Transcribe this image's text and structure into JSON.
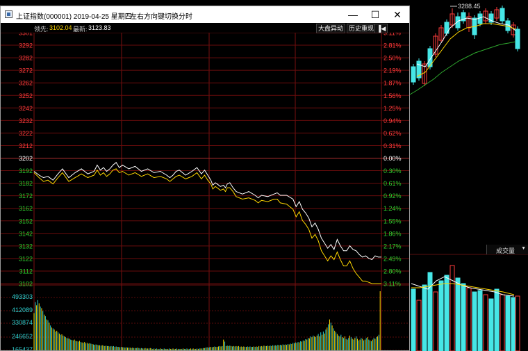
{
  "window": {
    "title": "上证指数(000001) 2019-04-25 星期四",
    "hint": "左右方向键切换分时",
    "minimize": "—",
    "maximize": "☐",
    "close": "✕"
  },
  "infobar": {
    "leader_label": "领先:",
    "leader_value": "3102.04",
    "latest_label": "最新:",
    "latest_value": "3123.83",
    "btn_market": "大盘异动",
    "btn_history": "历史重现",
    "btn_pin": "▐◀"
  },
  "background_kline": {
    "high_label": "3288.45",
    "volume_tab": "成交量",
    "volume_arrow": "▼"
  },
  "chart_data": {
    "type": "line",
    "price_ticks": [
      "3301",
      "3292",
      "3282",
      "3272",
      "3262",
      "3252",
      "3242",
      "3232",
      "3222",
      "3212",
      "3202",
      "3192",
      "3182",
      "3172",
      "3162",
      "3152",
      "3142",
      "3132",
      "3122",
      "3112",
      "3102"
    ],
    "pct_ticks": [
      "3.11%",
      "2.81%",
      "2.50%",
      "2.19%",
      "1.87%",
      "1.56%",
      "1.25%",
      "0.94%",
      "0.62%",
      "0.31%",
      "0.00%",
      "0.30%",
      "0.61%",
      "0.92%",
      "1.24%",
      "1.55%",
      "1.86%",
      "2.17%",
      "2.49%",
      "2.80%",
      "3.11%"
    ],
    "pre_close": 3202,
    "ylim": [
      3102,
      3301
    ],
    "volume_ticks": [
      "493303",
      "412089",
      "330874",
      "246652",
      "165437"
    ],
    "volume_max": 540000,
    "series": [
      {
        "x": [
          0,
          8,
          15,
          22,
          30,
          38,
          45,
          55,
          65,
          75,
          85,
          95,
          100,
          105,
          110,
          115,
          120,
          125,
          130,
          135,
          140,
          150,
          160,
          170,
          180,
          190,
          200,
          210,
          215,
          220,
          225,
          230,
          240,
          250,
          258,
          265,
          270,
          275,
          280,
          283,
          287,
          290,
          295,
          300,
          303,
          306,
          310,
          315,
          320,
          330,
          340,
          350,
          355,
          360,
          370,
          380,
          385,
          390,
          400,
          410,
          415,
          420,
          425,
          430,
          435,
          440,
          445,
          450,
          455,
          460,
          465,
          470,
          475,
          480,
          485,
          490,
          495,
          500,
          505,
          510,
          515,
          520,
          525,
          530,
          535,
          540,
          545,
          550
        ],
        "values": [
          3191,
          3188,
          3186,
          3187,
          3184,
          3189,
          3193,
          3186,
          3190,
          3193,
          3189,
          3191,
          3196,
          3192,
          3194,
          3191,
          3193,
          3196,
          3198,
          3194,
          3196,
          3193,
          3195,
          3191,
          3193,
          3190,
          3191,
          3188,
          3186,
          3188,
          3191,
          3192,
          3188,
          3191,
          3194,
          3189,
          3192,
          3188,
          3184,
          3180,
          3182,
          3181,
          3179,
          3180,
          3178,
          3181,
          3182,
          3178,
          3175,
          3173,
          3175,
          3172,
          3170,
          3172,
          3171,
          3173,
          3174,
          3172,
          3172,
          3169,
          3163,
          3167,
          3161,
          3158,
          3154,
          3147,
          3150,
          3145,
          3138,
          3134,
          3130,
          3133,
          3129,
          3137,
          3132,
          3128,
          3128,
          3132,
          3129,
          3128,
          3125,
          3123,
          3124,
          3122,
          3121,
          3124,
          3123,
          3123
        ]
      },
      {
        "x": [
          0,
          8,
          15,
          22,
          30,
          38,
          45,
          55,
          65,
          75,
          85,
          95,
          100,
          105,
          110,
          115,
          120,
          125,
          130,
          135,
          140,
          150,
          160,
          170,
          180,
          190,
          200,
          210,
          215,
          220,
          225,
          230,
          240,
          250,
          258,
          265,
          270,
          275,
          280,
          283,
          287,
          290,
          295,
          300,
          303,
          306,
          310,
          315,
          320,
          330,
          340,
          350,
          355,
          360,
          370,
          380,
          385,
          390,
          400,
          410,
          415,
          420,
          425,
          430,
          435,
          440,
          445,
          450,
          455,
          460,
          465,
          470,
          475,
          480,
          485,
          490,
          495,
          500,
          505,
          510,
          515,
          520,
          525,
          530,
          535,
          540,
          545,
          550
        ],
        "values": [
          3190,
          3186,
          3183,
          3184,
          3181,
          3186,
          3190,
          3183,
          3186,
          3189,
          3186,
          3188,
          3192,
          3188,
          3190,
          3187,
          3189,
          3192,
          3193,
          3190,
          3191,
          3188,
          3190,
          3187,
          3189,
          3186,
          3187,
          3185,
          3183,
          3185,
          3187,
          3188,
          3185,
          3187,
          3190,
          3185,
          3188,
          3184,
          3181,
          3177,
          3179,
          3178,
          3176,
          3177,
          3175,
          3178,
          3178,
          3175,
          3171,
          3169,
          3170,
          3168,
          3166,
          3168,
          3167,
          3169,
          3169,
          3166,
          3165,
          3161,
          3155,
          3159,
          3152,
          3149,
          3145,
          3138,
          3141,
          3136,
          3128,
          3124,
          3120,
          3124,
          3121,
          3127,
          3121,
          3116,
          3116,
          3120,
          3114,
          3110,
          3107,
          3104,
          3104,
          3103,
          3102,
          3102,
          3102,
          3102
        ]
      }
    ],
    "volume": [
      [
        0,
        96
      ],
      [
        2,
        123
      ],
      [
        4,
        115
      ],
      [
        6,
        128
      ],
      [
        8,
        120
      ],
      [
        10,
        112
      ],
      [
        12,
        108
      ],
      [
        14,
        101
      ],
      [
        16,
        92
      ],
      [
        18,
        88
      ],
      [
        20,
        80
      ],
      [
        22,
        78
      ],
      [
        24,
        72
      ],
      [
        26,
        65
      ],
      [
        28,
        60
      ],
      [
        30,
        58
      ],
      [
        32,
        55
      ],
      [
        34,
        50
      ],
      [
        36,
        52
      ],
      [
        38,
        48
      ],
      [
        40,
        45
      ],
      [
        42,
        42
      ],
      [
        44,
        43
      ],
      [
        46,
        40
      ],
      [
        48,
        38
      ],
      [
        50,
        36
      ],
      [
        52,
        34
      ],
      [
        54,
        33
      ],
      [
        56,
        32
      ],
      [
        58,
        30
      ],
      [
        60,
        29
      ],
      [
        62,
        28
      ],
      [
        64,
        30
      ],
      [
        66,
        27
      ],
      [
        68,
        26
      ],
      [
        70,
        25
      ],
      [
        72,
        27
      ],
      [
        74,
        24
      ],
      [
        76,
        23
      ],
      [
        78,
        22
      ],
      [
        80,
        24
      ],
      [
        82,
        21
      ],
      [
        84,
        22
      ],
      [
        86,
        20
      ],
      [
        88,
        21
      ],
      [
        90,
        20
      ],
      [
        92,
        19
      ],
      [
        94,
        18
      ],
      [
        96,
        17
      ],
      [
        98,
        18
      ],
      [
        100,
        17
      ],
      [
        102,
        16
      ],
      [
        104,
        16
      ],
      [
        106,
        15
      ],
      [
        108,
        16
      ],
      [
        110,
        15
      ],
      [
        112,
        14
      ],
      [
        114,
        15
      ],
      [
        116,
        14
      ],
      [
        118,
        14
      ],
      [
        120,
        13
      ],
      [
        122,
        14
      ],
      [
        124,
        13
      ],
      [
        126,
        14
      ],
      [
        128,
        12
      ],
      [
        130,
        13
      ],
      [
        132,
        12
      ],
      [
        134,
        12
      ],
      [
        136,
        11
      ],
      [
        138,
        12
      ],
      [
        140,
        11
      ],
      [
        142,
        11
      ],
      [
        144,
        10
      ],
      [
        146,
        11
      ],
      [
        148,
        10
      ],
      [
        150,
        10
      ],
      [
        152,
        10
      ],
      [
        154,
        9
      ],
      [
        156,
        10
      ],
      [
        158,
        9
      ],
      [
        160,
        9
      ],
      [
        162,
        9
      ],
      [
        164,
        10
      ],
      [
        166,
        9
      ],
      [
        168,
        8
      ],
      [
        170,
        9
      ],
      [
        172,
        8
      ],
      [
        174,
        8
      ],
      [
        176,
        9
      ],
      [
        178,
        8
      ],
      [
        180,
        8
      ],
      [
        182,
        8
      ],
      [
        184,
        9
      ],
      [
        186,
        8
      ],
      [
        188,
        7
      ],
      [
        190,
        8
      ],
      [
        192,
        7
      ],
      [
        194,
        8
      ],
      [
        196,
        7
      ],
      [
        198,
        7
      ],
      [
        200,
        8
      ],
      [
        202,
        7
      ],
      [
        204,
        7
      ],
      [
        206,
        8
      ],
      [
        208,
        7
      ],
      [
        210,
        7
      ],
      [
        212,
        7
      ],
      [
        214,
        8
      ],
      [
        216,
        7
      ],
      [
        218,
        7
      ],
      [
        220,
        8
      ],
      [
        222,
        7
      ],
      [
        224,
        7
      ],
      [
        226,
        8
      ],
      [
        228,
        7
      ],
      [
        230,
        7
      ],
      [
        232,
        7
      ],
      [
        234,
        7
      ],
      [
        236,
        8
      ],
      [
        238,
        7
      ],
      [
        240,
        7
      ],
      [
        242,
        8
      ],
      [
        244,
        7
      ],
      [
        246,
        7
      ],
      [
        248,
        8
      ],
      [
        250,
        7
      ],
      [
        252,
        8
      ],
      [
        254,
        7
      ],
      [
        256,
        7
      ],
      [
        258,
        8
      ],
      [
        260,
        7
      ],
      [
        262,
        8
      ],
      [
        264,
        8
      ],
      [
        266,
        8
      ],
      [
        268,
        9
      ],
      [
        270,
        9
      ],
      [
        272,
        10
      ],
      [
        274,
        11
      ],
      [
        276,
        10
      ],
      [
        278,
        11
      ],
      [
        280,
        12
      ],
      [
        282,
        11
      ],
      [
        284,
        12
      ],
      [
        286,
        13
      ],
      [
        288,
        12
      ],
      [
        290,
        12
      ],
      [
        292,
        13
      ],
      [
        294,
        14
      ],
      [
        296,
        13
      ],
      [
        298,
        14
      ],
      [
        300,
        30
      ],
      [
        302,
        25
      ],
      [
        304,
        14
      ],
      [
        306,
        15
      ],
      [
        308,
        14
      ],
      [
        310,
        15
      ],
      [
        312,
        14
      ],
      [
        314,
        13
      ],
      [
        316,
        14
      ],
      [
        318,
        13
      ],
      [
        320,
        14
      ],
      [
        322,
        13
      ],
      [
        324,
        14
      ],
      [
        326,
        12
      ],
      [
        328,
        13
      ],
      [
        330,
        12
      ],
      [
        332,
        13
      ],
      [
        334,
        12
      ],
      [
        336,
        12
      ],
      [
        338,
        13
      ],
      [
        340,
        12
      ],
      [
        342,
        13
      ],
      [
        344,
        12
      ],
      [
        346,
        12
      ],
      [
        348,
        13
      ],
      [
        350,
        12
      ],
      [
        352,
        13
      ],
      [
        354,
        12
      ],
      [
        356,
        14
      ],
      [
        358,
        13
      ],
      [
        360,
        14
      ],
      [
        362,
        13
      ],
      [
        364,
        15
      ],
      [
        366,
        14
      ],
      [
        368,
        14
      ],
      [
        370,
        15
      ],
      [
        372,
        14
      ],
      [
        374,
        15
      ],
      [
        376,
        14
      ],
      [
        378,
        16
      ],
      [
        380,
        15
      ],
      [
        382,
        16
      ],
      [
        384,
        15
      ],
      [
        386,
        17
      ],
      [
        388,
        16
      ],
      [
        390,
        17
      ],
      [
        392,
        16
      ],
      [
        394,
        18
      ],
      [
        396,
        17
      ],
      [
        398,
        18
      ],
      [
        400,
        17
      ],
      [
        402,
        19
      ],
      [
        404,
        18
      ],
      [
        406,
        20
      ],
      [
        408,
        19
      ],
      [
        410,
        22
      ],
      [
        412,
        21
      ],
      [
        414,
        23
      ],
      [
        416,
        22
      ],
      [
        418,
        24
      ],
      [
        420,
        23
      ],
      [
        422,
        26
      ],
      [
        424,
        25
      ],
      [
        426,
        28
      ],
      [
        428,
        27
      ],
      [
        430,
        31
      ],
      [
        432,
        30
      ],
      [
        434,
        34
      ],
      [
        436,
        33
      ],
      [
        438,
        38
      ],
      [
        440,
        36
      ],
      [
        442,
        40
      ],
      [
        444,
        38
      ],
      [
        446,
        36
      ],
      [
        448,
        40
      ],
      [
        450,
        44
      ],
      [
        452,
        38
      ],
      [
        454,
        48
      ],
      [
        456,
        42
      ],
      [
        458,
        50
      ],
      [
        460,
        45
      ],
      [
        462,
        55
      ],
      [
        464,
        60
      ],
      [
        466,
        68
      ],
      [
        468,
        80
      ],
      [
        470,
        72
      ],
      [
        472,
        65
      ],
      [
        474,
        58
      ],
      [
        476,
        52
      ],
      [
        478,
        48
      ],
      [
        480,
        44
      ],
      [
        482,
        40
      ],
      [
        484,
        38
      ],
      [
        486,
        42
      ],
      [
        488,
        36
      ],
      [
        490,
        34
      ],
      [
        492,
        38
      ],
      [
        494,
        32
      ],
      [
        496,
        30
      ],
      [
        498,
        34
      ],
      [
        500,
        40
      ],
      [
        502,
        36
      ],
      [
        504,
        32
      ],
      [
        506,
        30
      ],
      [
        508,
        34
      ],
      [
        510,
        38
      ],
      [
        512,
        32
      ],
      [
        514,
        28
      ],
      [
        516,
        30
      ],
      [
        518,
        34
      ],
      [
        520,
        32
      ],
      [
        522,
        28
      ],
      [
        524,
        30
      ],
      [
        526,
        34
      ],
      [
        528,
        36
      ],
      [
        530,
        30
      ],
      [
        532,
        28
      ],
      [
        534,
        26
      ],
      [
        536,
        30
      ],
      [
        538,
        34
      ],
      [
        540,
        32
      ],
      [
        542,
        36
      ],
      [
        544,
        38
      ],
      [
        546,
        42
      ],
      [
        548,
        150
      ]
    ]
  }
}
